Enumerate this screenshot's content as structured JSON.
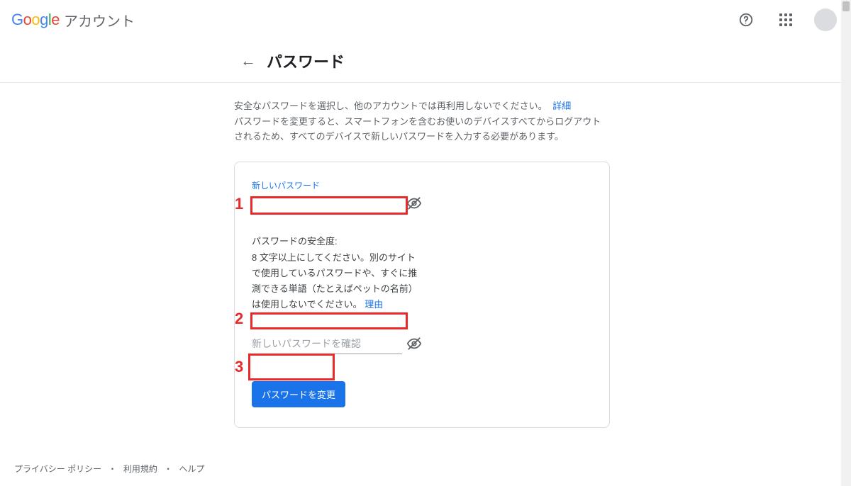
{
  "header": {
    "product": "Google",
    "section": "アカウント"
  },
  "page": {
    "title": "パスワード",
    "intro_line_1": "安全なパスワードを選択し、他のアカウントでは再利用しないでください。",
    "intro_more_link": "詳細",
    "intro_line_2": "パスワードを変更すると、スマートフォンを含むお使いのデバイスすべてからログアウトされるため、すべてのデバイスで新しいパスワードを入力する必要があります。"
  },
  "form": {
    "new_password_label": "新しいパスワード",
    "strength_title": "パスワードの安全度:",
    "strength_body_prefix": "8 文字以上にしてください。別のサイトで使用しているパスワードや、すぐに推測できる単語（たとえばペットの名前）は使用しないでください。",
    "strength_reason_link": "理由",
    "confirm_placeholder": "新しいパスワードを確認",
    "submit_label": "パスワードを変更"
  },
  "footer": {
    "privacy": "プライバシー ポリシー",
    "terms": "利用規約",
    "help": "ヘルプ"
  },
  "annotations": {
    "num1": "1",
    "num2": "2",
    "num3": "3"
  }
}
